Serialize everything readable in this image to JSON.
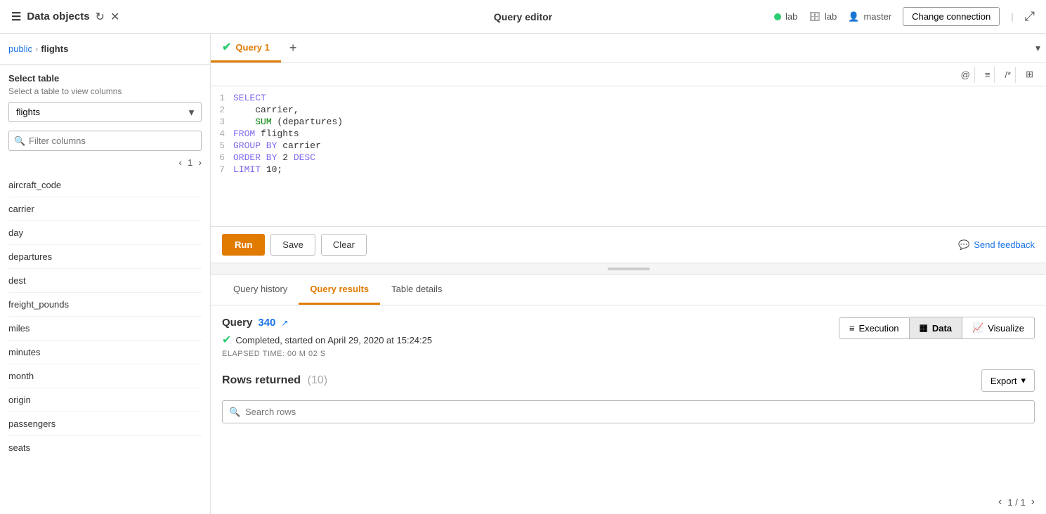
{
  "app": {
    "title": "Data objects",
    "query_editor_title": "Query editor"
  },
  "header": {
    "status_label": "lab",
    "db_label": "lab",
    "user_label": "master",
    "change_connection": "Change connection"
  },
  "sidebar": {
    "title": "Data objects",
    "breadcrumb_public": "public",
    "breadcrumb_table": "flights",
    "select_table_label": "Select table",
    "select_table_hint": "Select a table to view columns",
    "table_selected": "flights",
    "filter_placeholder": "Filter columns",
    "page_number": "1",
    "columns": [
      {
        "name": "aircraft_code"
      },
      {
        "name": "carrier"
      },
      {
        "name": "day"
      },
      {
        "name": "departures"
      },
      {
        "name": "dest"
      },
      {
        "name": "freight_pounds"
      },
      {
        "name": "miles"
      },
      {
        "name": "minutes"
      },
      {
        "name": "month"
      },
      {
        "name": "origin"
      },
      {
        "name": "passengers"
      },
      {
        "name": "seats"
      }
    ]
  },
  "editor": {
    "tab_label": "Query 1",
    "add_tab_label": "+",
    "toolbar": {
      "at_icon": "@",
      "list_icon": "≡",
      "comment_icon": "/*",
      "grid_icon": "⊞"
    },
    "code_lines": [
      {
        "num": "1",
        "content": "SELECT",
        "type": "keyword"
      },
      {
        "num": "2",
        "content": "    carrier,",
        "type": "text"
      },
      {
        "num": "3",
        "content": "    SUM (departures)",
        "type": "mixed"
      },
      {
        "num": "4",
        "content": "FROM flights",
        "type": "keyword-text"
      },
      {
        "num": "5",
        "content": "GROUP BY carrier",
        "type": "keyword-text"
      },
      {
        "num": "6",
        "content": "ORDER BY 2 DESC",
        "type": "keyword-text"
      },
      {
        "num": "7",
        "content": "LIMIT 10;",
        "type": "keyword-text"
      }
    ],
    "run_label": "Run",
    "save_label": "Save",
    "clear_label": "Clear",
    "send_feedback_label": "Send feedback"
  },
  "results": {
    "tab_history": "Query history",
    "tab_results": "Query results",
    "tab_details": "Table details",
    "active_tab": "Query results",
    "query_label": "Query",
    "query_number": "340",
    "completed_text": "Completed, started on April 29, 2020 at 15:24:25",
    "elapsed_label": "ELAPSED TIME: 00 m 02 s",
    "view_execution": "Execution",
    "view_data": "Data",
    "view_visualize": "Visualize",
    "active_view": "Data",
    "rows_returned_label": "Rows returned",
    "rows_count": "(10)",
    "export_label": "Export",
    "search_placeholder": "Search rows"
  }
}
